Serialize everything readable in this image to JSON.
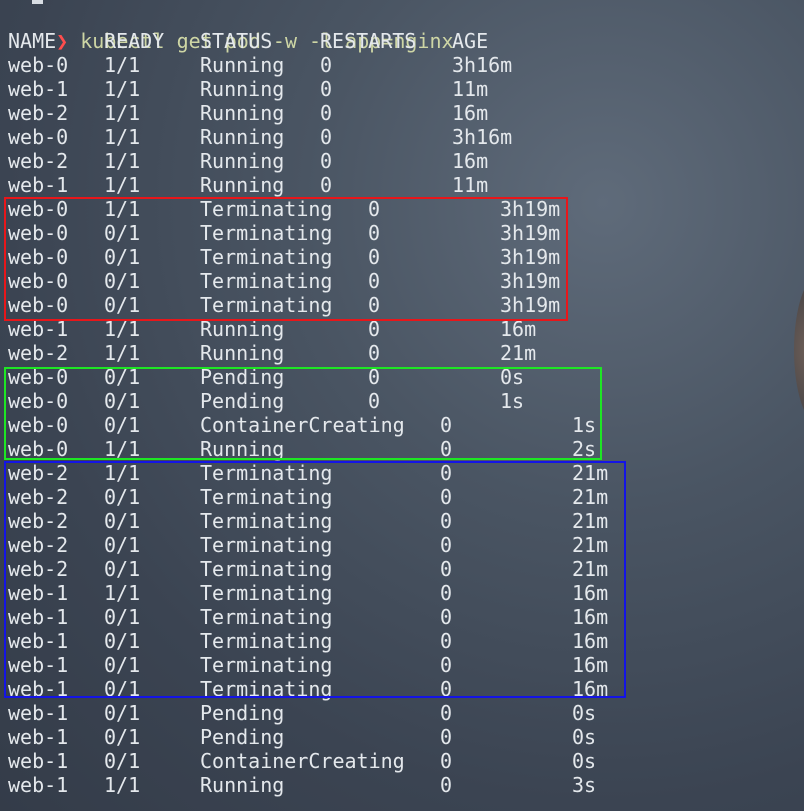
{
  "prompt": {
    "symbol": "❯",
    "command": "kubectl get pod -w -l app=nginx"
  },
  "headers": {
    "name": "NAME",
    "ready": "READY",
    "status": "STATUS",
    "restarts": "RESTARTS",
    "age": "AGE"
  },
  "rows": [
    {
      "name": "web-0",
      "ready": "1/1",
      "status": "Running",
      "restarts": "0",
      "age": "3h16m"
    },
    {
      "name": "web-1",
      "ready": "1/1",
      "status": "Running",
      "restarts": "0",
      "age": "11m"
    },
    {
      "name": "web-2",
      "ready": "1/1",
      "status": "Running",
      "restarts": "0",
      "age": "16m"
    },
    {
      "name": "web-0",
      "ready": "1/1",
      "status": "Running",
      "restarts": "0",
      "age": "3h16m"
    },
    {
      "name": "web-2",
      "ready": "1/1",
      "status": "Running",
      "restarts": "0",
      "age": "16m"
    },
    {
      "name": "web-1",
      "ready": "1/1",
      "status": "Running",
      "restarts": "0",
      "age": "11m"
    },
    {
      "name": "web-0",
      "ready": "1/1",
      "status": "Terminating",
      "restarts": "0",
      "age": "3h19m"
    },
    {
      "name": "web-0",
      "ready": "0/1",
      "status": "Terminating",
      "restarts": "0",
      "age": "3h19m"
    },
    {
      "name": "web-0",
      "ready": "0/1",
      "status": "Terminating",
      "restarts": "0",
      "age": "3h19m"
    },
    {
      "name": "web-0",
      "ready": "0/1",
      "status": "Terminating",
      "restarts": "0",
      "age": "3h19m"
    },
    {
      "name": "web-0",
      "ready": "0/1",
      "status": "Terminating",
      "restarts": "0",
      "age": "3h19m"
    },
    {
      "name": "web-1",
      "ready": "1/1",
      "status": "Running",
      "restarts": "0",
      "age": "16m"
    },
    {
      "name": "web-2",
      "ready": "1/1",
      "status": "Running",
      "restarts": "0",
      "age": "21m"
    },
    {
      "name": "web-0",
      "ready": "0/1",
      "status": "Pending",
      "restarts": "0",
      "age": "0s"
    },
    {
      "name": "web-0",
      "ready": "0/1",
      "status": "Pending",
      "restarts": "0",
      "age": "1s"
    },
    {
      "name": "web-0",
      "ready": "0/1",
      "status": "ContainerCreating",
      "restarts": "0",
      "age": "1s"
    },
    {
      "name": "web-0",
      "ready": "1/1",
      "status": "Running",
      "restarts": "0",
      "age": "2s"
    },
    {
      "name": "web-2",
      "ready": "1/1",
      "status": "Terminating",
      "restarts": "0",
      "age": "21m"
    },
    {
      "name": "web-2",
      "ready": "0/1",
      "status": "Terminating",
      "restarts": "0",
      "age": "21m"
    },
    {
      "name": "web-2",
      "ready": "0/1",
      "status": "Terminating",
      "restarts": "0",
      "age": "21m"
    },
    {
      "name": "web-2",
      "ready": "0/1",
      "status": "Terminating",
      "restarts": "0",
      "age": "21m"
    },
    {
      "name": "web-2",
      "ready": "0/1",
      "status": "Terminating",
      "restarts": "0",
      "age": "21m"
    },
    {
      "name": "web-1",
      "ready": "1/1",
      "status": "Terminating",
      "restarts": "0",
      "age": "16m"
    },
    {
      "name": "web-1",
      "ready": "0/1",
      "status": "Terminating",
      "restarts": "0",
      "age": "16m"
    },
    {
      "name": "web-1",
      "ready": "0/1",
      "status": "Terminating",
      "restarts": "0",
      "age": "16m"
    },
    {
      "name": "web-1",
      "ready": "0/1",
      "status": "Terminating",
      "restarts": "0",
      "age": "16m"
    },
    {
      "name": "web-1",
      "ready": "0/1",
      "status": "Terminating",
      "restarts": "0",
      "age": "16m"
    },
    {
      "name": "web-1",
      "ready": "0/1",
      "status": "Pending",
      "restarts": "0",
      "age": "0s"
    },
    {
      "name": "web-1",
      "ready": "0/1",
      "status": "Pending",
      "restarts": "0",
      "age": "0s"
    },
    {
      "name": "web-1",
      "ready": "0/1",
      "status": "ContainerCreating",
      "restarts": "0",
      "age": "0s"
    },
    {
      "name": "web-1",
      "ready": "1/1",
      "status": "Running",
      "restarts": "0",
      "age": "3s"
    }
  ],
  "highlights": [
    {
      "color": "red",
      "hex": "#e8161a"
    },
    {
      "color": "green",
      "hex": "#1ee624"
    },
    {
      "color": "blue",
      "hex": "#1414e6"
    }
  ]
}
